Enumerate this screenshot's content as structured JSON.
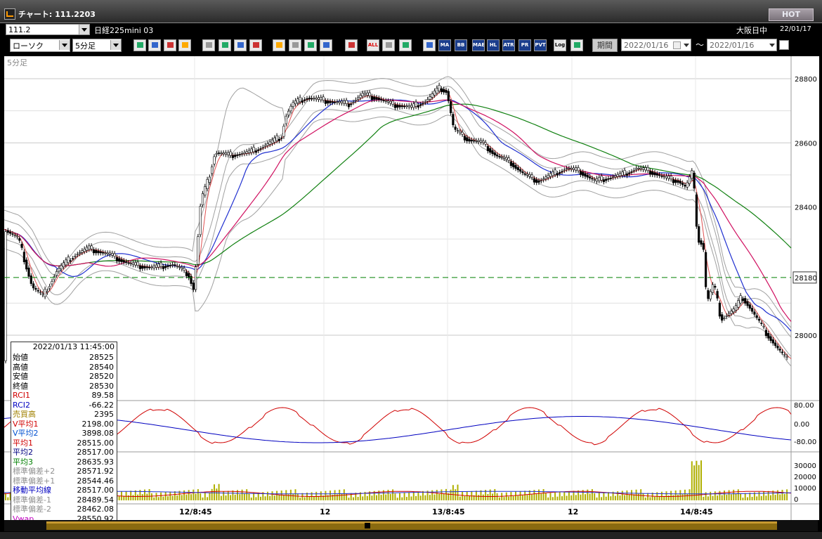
{
  "window": {
    "title": "チャート: 111.2203",
    "hot_label": "HOT"
  },
  "bar1": {
    "code_value": "111.2",
    "instrument": "日経225mini 03",
    "session": "大阪日中",
    "date": "22/01/17"
  },
  "bar2": {
    "chart_type": "ローソク",
    "timeframe": "5分足",
    "buttons": [
      "MA",
      "BB",
      "MAE",
      "HL",
      "ATR",
      "PR RA",
      "PVT",
      "Log"
    ],
    "all_label": "ALL",
    "kikan_label": "期間",
    "date_from": "2022/01/16",
    "date_to": "2022/01/16",
    "tilde": "〜"
  },
  "chart": {
    "timeframe_label": "5分足",
    "price_ticks": [
      "28800",
      "28600",
      "28400",
      "28180",
      "28000"
    ],
    "current_price": "28180",
    "osc_ticks": [
      "80.00",
      "0.00",
      "-80.00"
    ],
    "volume_ticks": [
      "30000",
      "20000",
      "10000",
      "0"
    ],
    "time_labels": [
      "12/8:45",
      "12",
      "13/8:45",
      "12",
      "14/8:45"
    ]
  },
  "info": {
    "header": "2022/01/13 11:45:00",
    "rows": [
      {
        "k": "始値",
        "v": "28525",
        "color": "#000"
      },
      {
        "k": "高値",
        "v": "28540",
        "color": "#000"
      },
      {
        "k": "安値",
        "v": "28520",
        "color": "#000"
      },
      {
        "k": "終値",
        "v": "28530",
        "color": "#000"
      },
      {
        "k": "RCI1",
        "v": "89.58",
        "color": "#d00000"
      },
      {
        "k": "RCI2",
        "v": "-66.22",
        "color": "#0000c0"
      },
      {
        "k": "売買高",
        "v": "2395",
        "color": "#a08000"
      },
      {
        "k": "V平均1",
        "v": "2198.00",
        "color": "#d00000"
      },
      {
        "k": "V平均2",
        "v": "3898.08",
        "color": "#0050d0"
      },
      {
        "k": "平均1",
        "v": "28515.00",
        "color": "#d00000"
      },
      {
        "k": "平均2",
        "v": "28517.00",
        "color": "#000080"
      },
      {
        "k": "平均3",
        "v": "28635.93",
        "color": "#008000"
      },
      {
        "k": "標準偏差+2",
        "v": "28571.92",
        "color": "#909090"
      },
      {
        "k": "標準偏差+1",
        "v": "28544.46",
        "color": "#909090"
      },
      {
        "k": "移動平均線",
        "v": "28517.00",
        "color": "#0000c0"
      },
      {
        "k": "標準偏差-1",
        "v": "28489.54",
        "color": "#909090"
      },
      {
        "k": "標準偏差-2",
        "v": "28462.08",
        "color": "#909090"
      },
      {
        "k": "Vwap",
        "v": "28550.92",
        "color": "#c000c0"
      }
    ]
  },
  "colors": {
    "ma1": "#d01060",
    "ma2": "#2030d0",
    "ma3": "#108010",
    "bb": "#a0a0a0",
    "rci1": "#d00000",
    "rci2": "#0000c0",
    "volume": "#b0b000",
    "current": "#008000"
  }
}
